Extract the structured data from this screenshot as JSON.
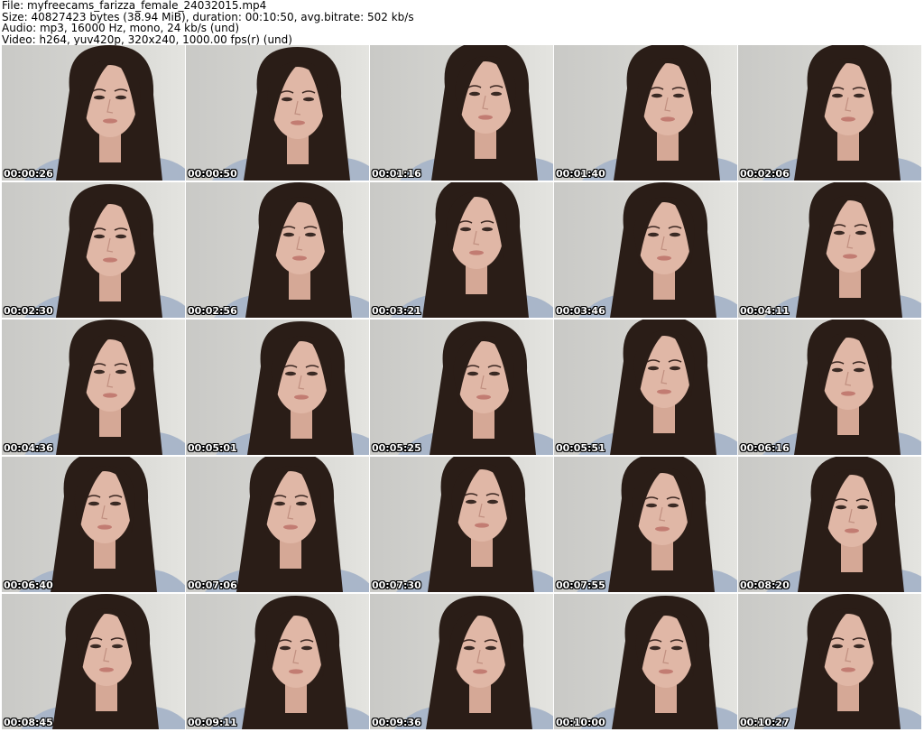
{
  "header": {
    "file_line": "File: myfreecams_farizza_female_24032015.mp4",
    "size_line": "Size: 40827423 bytes (38.94 MiB), duration: 00:10:50, avg.bitrate: 502 kb/s",
    "audio_line": "Audio: mp3, 16000 Hz, mono, 24 kb/s (und)",
    "video_line": "Video: h264, yuv420p, 320x240, 1000.00 fps(r) (und)"
  },
  "thumbnails": [
    {
      "timestamp": "00:00:26"
    },
    {
      "timestamp": "00:00:50"
    },
    {
      "timestamp": "00:01:16"
    },
    {
      "timestamp": "00:01:40"
    },
    {
      "timestamp": "00:02:06"
    },
    {
      "timestamp": "00:02:30"
    },
    {
      "timestamp": "00:02:56"
    },
    {
      "timestamp": "00:03:21"
    },
    {
      "timestamp": "00:03:46"
    },
    {
      "timestamp": "00:04:11"
    },
    {
      "timestamp": "00:04:36"
    },
    {
      "timestamp": "00:05:01"
    },
    {
      "timestamp": "00:05:25"
    },
    {
      "timestamp": "00:05:51"
    },
    {
      "timestamp": "00:06:16"
    },
    {
      "timestamp": "00:06:40"
    },
    {
      "timestamp": "00:07:06"
    },
    {
      "timestamp": "00:07:30"
    },
    {
      "timestamp": "00:07:55"
    },
    {
      "timestamp": "00:08:20"
    },
    {
      "timestamp": "00:08:45"
    },
    {
      "timestamp": "00:09:11"
    },
    {
      "timestamp": "00:09:36"
    },
    {
      "timestamp": "00:10:00"
    },
    {
      "timestamp": "00:10:27"
    }
  ],
  "colors": {
    "wall": "#d6d6d2",
    "hair": "#2a1d17",
    "skin": "#e0b7a6",
    "shirt": "#a9b6c9"
  }
}
